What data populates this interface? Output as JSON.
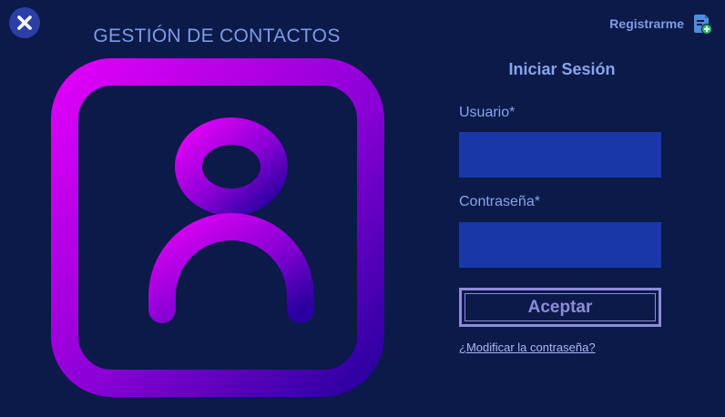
{
  "header": {
    "app_title": "GESTIÓN DE CONTACTOS",
    "close_icon": "close-icon",
    "register_label": "Registrarme",
    "register_icon": "add-user-document-icon"
  },
  "login": {
    "title": "Iniciar Sesión",
    "username_label": "Usuario*",
    "username_value": "",
    "password_label": "Contraseña*",
    "password_value": "",
    "submit_label": "Aceptar",
    "forgot_password_link": "¿Modificar la contraseña?"
  },
  "illustration": {
    "icon": "contact-book-icon"
  },
  "colors": {
    "background": "#0b1a49",
    "title_text": "#7f9ae6",
    "input_fill": "#1a37a8",
    "button_border": "#8e8bd9",
    "gradient_start": "#e000f6",
    "gradient_end": "#2a00a0",
    "close_button": "#2c3fa6"
  }
}
